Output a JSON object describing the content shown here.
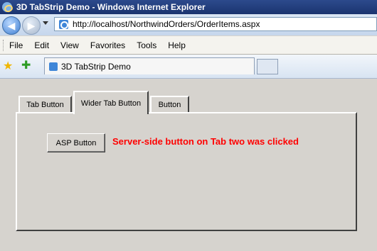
{
  "window": {
    "title": "3D TabStrip Demo - Windows Internet Explorer"
  },
  "address_bar": {
    "url": "http://localhost/NorthwindOrders/OrderItems.aspx"
  },
  "menu": {
    "items": [
      "File",
      "Edit",
      "View",
      "Favorites",
      "Tools",
      "Help"
    ]
  },
  "browser_tab": {
    "title": "3D TabStrip Demo"
  },
  "tabstrip": {
    "tabs": [
      {
        "label": "Tab Button",
        "selected": false
      },
      {
        "label": "Wider Tab Button",
        "selected": true
      },
      {
        "label": "Button",
        "selected": false
      }
    ]
  },
  "panel": {
    "asp_button_label": "ASP Button",
    "status_message": "Server-side button on Tab two was clicked",
    "status_color": "#ff0000"
  }
}
